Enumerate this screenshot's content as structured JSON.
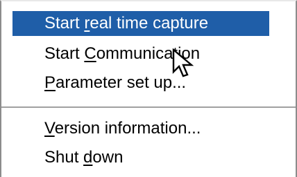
{
  "menu": {
    "items": [
      {
        "label": "Start real time capture",
        "pre": "Start ",
        "accel": "r",
        "post": "eal time capture",
        "highlighted": true
      },
      {
        "label": "Start Communication",
        "pre": "Start ",
        "accel": "C",
        "post": "ommunication",
        "highlighted": false
      },
      {
        "label": "Parameter set up...",
        "pre": "",
        "accel": "P",
        "post": "arameter set up...",
        "highlighted": false
      },
      {
        "label": "Version information...",
        "pre": "",
        "accel": "V",
        "post": "ersion information...",
        "highlighted": false
      },
      {
        "label": "Shut down",
        "pre": "Shut ",
        "accel": "d",
        "post": "own",
        "highlighted": false
      }
    ]
  },
  "colors": {
    "highlight_bg": "#1f5ea8",
    "highlight_fg": "#ffffff",
    "menu_bg": "#ffffff"
  },
  "icons": {
    "cursor": "mouse-pointer-arrow-icon"
  }
}
